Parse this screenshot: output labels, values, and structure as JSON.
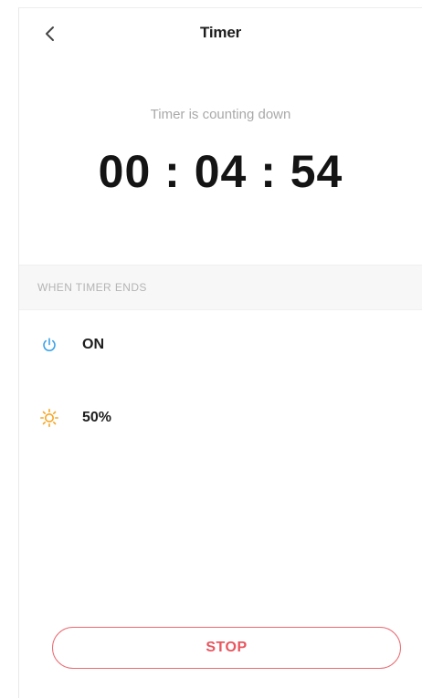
{
  "header": {
    "title": "Timer",
    "back_icon": "chevron-left-icon"
  },
  "countdown": {
    "status": "Timer is counting down",
    "time": "00 : 04 : 54"
  },
  "section": {
    "label": "WHEN TIMER ENDS"
  },
  "actions": [
    {
      "icon": "power-icon",
      "label": "ON",
      "color": "#3aa3e8"
    },
    {
      "icon": "brightness-icon",
      "label": "50%",
      "color": "#f6a623"
    }
  ],
  "footer": {
    "stop_label": "STOP",
    "accent": "#e8555e"
  }
}
